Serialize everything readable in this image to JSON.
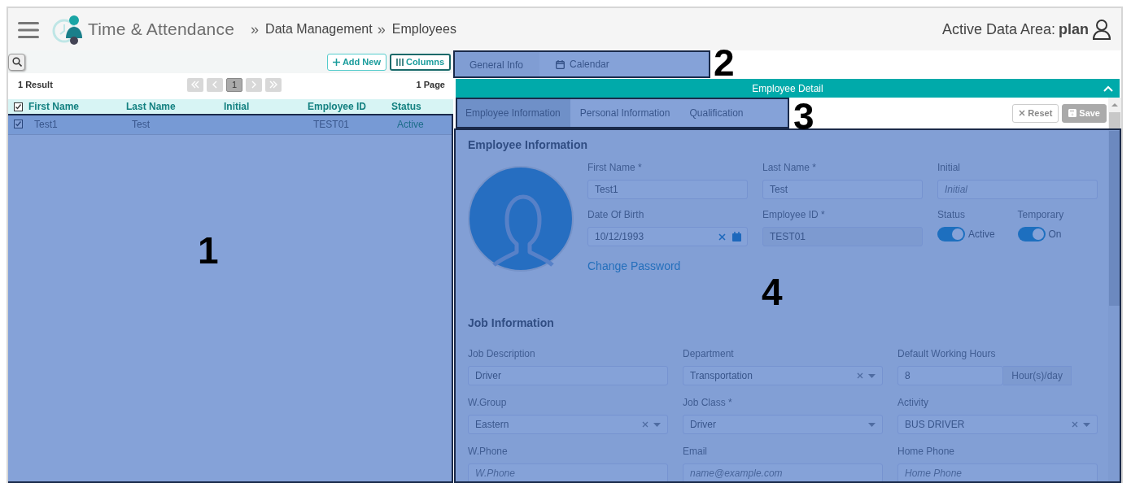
{
  "header": {
    "app_name": "Time & Attendance",
    "breadcrumbs": [
      {
        "separator": "»",
        "label": "Data Management"
      },
      {
        "separator": "»",
        "label": "Employees"
      }
    ],
    "data_area_label": "Active Data Area:",
    "data_area": "plan"
  },
  "list": {
    "buttons": [
      {
        "kind": "add",
        "label": "Add New"
      },
      {
        "kind": "columns",
        "label": "Columns"
      }
    ],
    "result_count": "1 Result",
    "pager": {
      "current": "1"
    },
    "page_count": "1 Page",
    "header_checked": true,
    "columns": [
      "First Name",
      "Last Name",
      "Initial",
      "Employee ID",
      "Status"
    ],
    "rows": [
      {
        "checked": true,
        "selected": true,
        "cells": [
          "Test1",
          "Test",
          "",
          "TEST01",
          "Active"
        ]
      }
    ]
  },
  "detail_tabs": [
    {
      "kind": "plain",
      "label": "General Info",
      "selected": true
    },
    {
      "kind": "calendar",
      "label": "Calendar",
      "selected": false
    }
  ],
  "detail_bar": {
    "title": "Employee Detail",
    "expanded": true
  },
  "sub_tabs": [
    {
      "label": "Employee Information",
      "selected": true
    },
    {
      "label": "Personal Information",
      "selected": false
    },
    {
      "label": "Qualification",
      "selected": false
    }
  ],
  "actions": [
    {
      "kind": "reset",
      "label": "Reset",
      "disabled": false
    },
    {
      "kind": "save",
      "label": "Save",
      "disabled": true
    }
  ],
  "employee_information": {
    "title": "Employee Information",
    "link": "Change Password",
    "fields": [
      {
        "kind": "text",
        "label": "First Name *",
        "value": "Test1"
      },
      {
        "kind": "text",
        "label": "Last Name *",
        "value": "Test"
      },
      {
        "kind": "text",
        "label": "Initial",
        "placeholder": "Initial"
      },
      {
        "kind": "date",
        "label": "Date Of Birth",
        "value": "10/12/1993"
      },
      {
        "kind": "text",
        "label": "Employee ID *",
        "value": "TEST01",
        "disabled": true
      },
      {
        "kind": "toggle",
        "label": "Status",
        "on": true,
        "text": "Active"
      },
      {
        "kind": "toggle",
        "label": "Temporary",
        "on": true,
        "text": "On"
      }
    ]
  },
  "job_information": {
    "title": "Job Information",
    "fields": [
      {
        "kind": "text",
        "label": "Job Description",
        "value": "Driver"
      },
      {
        "kind": "select",
        "label": "Department",
        "value": "Transportation",
        "clearable": true
      },
      {
        "kind": "addon",
        "label": "Default Working Hours",
        "value": "8",
        "addon": "Hour(s)/day"
      },
      {
        "kind": "select",
        "label": "W.Group",
        "value": "Eastern",
        "clearable": true
      },
      {
        "kind": "select",
        "label": "Job Class *",
        "value": "Driver",
        "clearable": false
      },
      {
        "kind": "select",
        "label": "Activity",
        "value": "BUS DRIVER",
        "clearable": true
      },
      {
        "kind": "text",
        "label": "W.Phone",
        "placeholder": "W.Phone"
      },
      {
        "kind": "text",
        "label": "Email",
        "placeholder": "name@example.com"
      },
      {
        "kind": "text",
        "label": "Home Phone",
        "placeholder": "Home Phone"
      }
    ]
  },
  "annotations": [
    "1",
    "2",
    "3",
    "4"
  ]
}
